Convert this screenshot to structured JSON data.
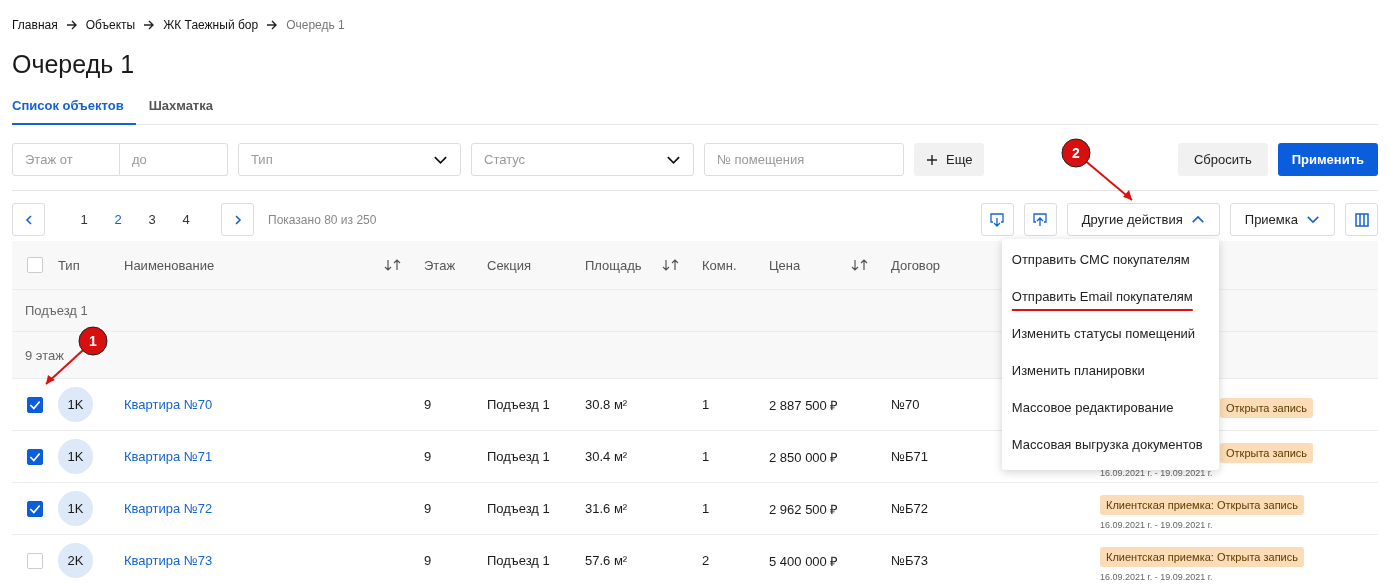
{
  "breadcrumbs": [
    {
      "label": "Главная",
      "current": false
    },
    {
      "label": "Объекты",
      "current": false
    },
    {
      "label": "ЖК Таежный бор",
      "current": false
    },
    {
      "label": "Очередь 1",
      "current": true
    }
  ],
  "title": "Очередь 1",
  "tabs": [
    {
      "label": "Список объектов",
      "selected": true
    },
    {
      "label": "Шахматка",
      "selected": false
    }
  ],
  "filters": {
    "floor_from": {
      "placeholder": "Этаж от"
    },
    "floor_to": {
      "placeholder": "до"
    },
    "type": {
      "placeholder": "Тип"
    },
    "status": {
      "placeholder": "Статус"
    },
    "room_number": {
      "placeholder": "№ помещения"
    },
    "more_button": "Еще",
    "reset_button": "Сбросить",
    "apply_button": "Применить"
  },
  "pagination": {
    "pages": [
      {
        "label": "1",
        "selected": false
      },
      {
        "label": "2",
        "selected": true
      },
      {
        "label": "3",
        "selected": false
      },
      {
        "label": "4",
        "selected": false
      }
    ],
    "summary": "Показано 80 из 250"
  },
  "actions": {
    "other_actions": {
      "label": "Другие действия",
      "expanded": true
    },
    "acceptance": {
      "label": "Приемка",
      "expanded": false
    },
    "menu": [
      {
        "label": "Отправить СМС покупателям",
        "underlined": false
      },
      {
        "label": "Отправить Email покупателям",
        "underlined": true
      },
      {
        "label": "Изменить статусы помещений",
        "underlined": false
      },
      {
        "label": "Изменить планировки",
        "underlined": false
      },
      {
        "label": "Массовое редактирование",
        "underlined": false
      },
      {
        "label": "Массовая выгрузка документов",
        "underlined": false
      }
    ]
  },
  "table": {
    "all_checked": false,
    "columns": [
      {
        "label": "Тип",
        "sortable": false
      },
      {
        "label": "Наименование",
        "sortable": true
      },
      {
        "label": "Этаж",
        "sortable": false
      },
      {
        "label": "Секция",
        "sortable": false
      },
      {
        "label": "Площадь",
        "sortable": true
      },
      {
        "label": "Комн.",
        "sortable": false
      },
      {
        "label": "Цена",
        "sortable": true
      },
      {
        "label": "Договор",
        "sortable": false
      }
    ],
    "groups": [
      "Подъезд 1",
      "9 этаж"
    ],
    "rows": [
      {
        "checked": true,
        "type": "1K",
        "name": "Квартира №70",
        "floor": "9",
        "section": "Подъезд 1",
        "area": "30.8 м²",
        "rooms": "1",
        "price": "2 887 500 ₽",
        "contract": "№70",
        "badge": "Открыта запись",
        "badge_covered": true
      },
      {
        "checked": true,
        "type": "1K",
        "name": "Квартира №71",
        "floor": "9",
        "section": "Подъезд 1",
        "area": "30.4 м²",
        "rooms": "1",
        "price": "2 850 000 ₽",
        "contract": "№Б71",
        "badge": "Открыта запись",
        "badge_covered": true,
        "dates": "16.09.2021 г. - 19.09.2021 г."
      },
      {
        "checked": true,
        "type": "1K",
        "name": "Квартира №72",
        "floor": "9",
        "section": "Подъезд 1",
        "area": "31.6 м²",
        "rooms": "1",
        "price": "2 962 500 ₽",
        "contract": "№Б72",
        "badge": "Клиентская приемка: Открыта запись",
        "badge_covered": false,
        "dates": "16.09.2021 г. - 19.09.2021 г."
      },
      {
        "checked": false,
        "type": "2K",
        "name": "Квартира №73",
        "floor": "9",
        "section": "Подъезд 1",
        "area": "57.6 м²",
        "rooms": "2",
        "price": "5 400 000 ₽",
        "contract": "№Б73",
        "badge": "Клиентская приемка: Открыта запись",
        "badge_covered": false,
        "dates": "16.09.2021 г. - 19.09.2021 г."
      }
    ]
  },
  "annotations": [
    {
      "label": "1"
    },
    {
      "label": "2"
    }
  ]
}
